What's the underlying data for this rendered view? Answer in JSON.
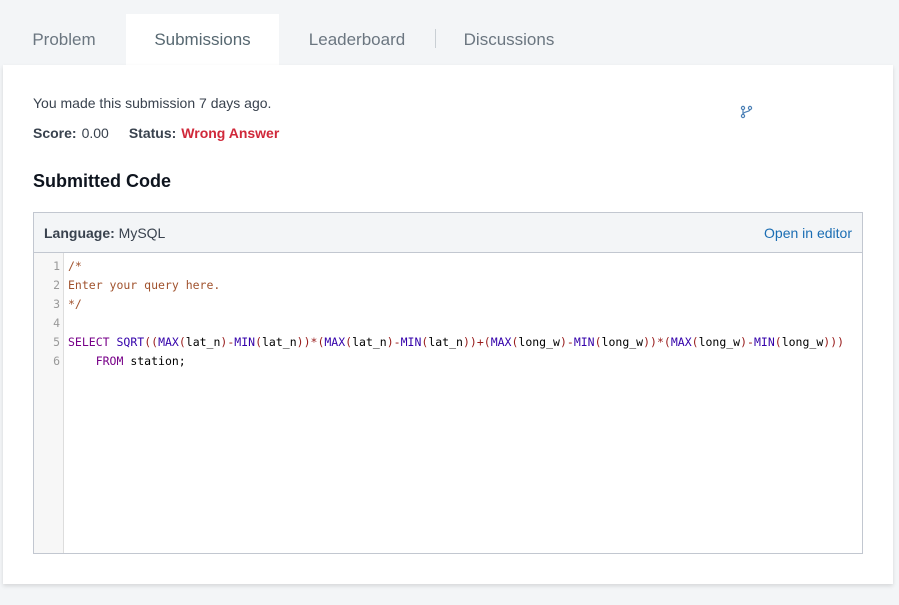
{
  "tabs": [
    {
      "label": "Problem",
      "active": false
    },
    {
      "label": "Submissions",
      "active": true
    },
    {
      "label": "Leaderboard",
      "active": false
    },
    {
      "label": "Discussions",
      "active": false
    }
  ],
  "submission": {
    "note": "You made this submission 7 days ago.",
    "score_label": "Score:",
    "score_value": "0.00",
    "status_label": "Status:",
    "status_value": "Wrong Answer",
    "status_color": "#d0283a"
  },
  "fork_icon": "fork-icon",
  "code": {
    "heading": "Submitted Code",
    "language_label": "Language:",
    "language_value": "MySQL",
    "open_editor": "Open in editor",
    "line_numbers": [
      "1",
      "2",
      "3",
      "4",
      "5",
      "6"
    ],
    "lines": [
      "/*",
      "Enter your query here.",
      "*/",
      "",
      "SELECT SQRT((MAX(lat_n)-MIN(lat_n))*(MAX(lat_n)-MIN(lat_n))+(MAX(long_w)-MIN(long_w))*(MAX(long_w)-MIN(long_w)))",
      "    FROM station;"
    ]
  }
}
